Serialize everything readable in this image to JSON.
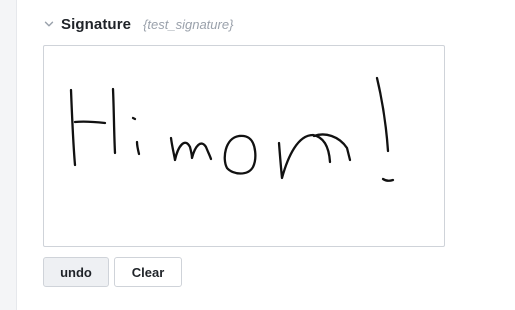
{
  "field": {
    "title": "Signature",
    "key": "{test_signature}"
  },
  "signature": {
    "handwritten_text": "Hi mom!",
    "ink_color": "#111111"
  },
  "buttons": {
    "undo_label": "undo",
    "clear_label": "Clear"
  }
}
